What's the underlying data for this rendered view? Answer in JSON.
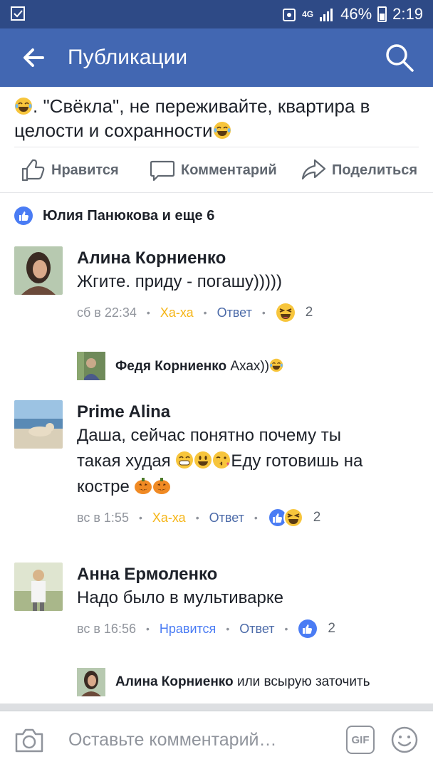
{
  "status": {
    "battery": "46%",
    "time": "2:19",
    "network": "4G"
  },
  "header": {
    "title": "Публикации"
  },
  "post": {
    "line1_start": ". \"Свёкла\", не переживайте, квартира в",
    "line2": "целости и сохранности"
  },
  "actions": {
    "like": "Нравится",
    "comment": "Комментарий",
    "share": "Поделиться"
  },
  "reactions": {
    "text": "Юлия Панюкова и еще 6"
  },
  "comments": [
    {
      "name": "Алина Корниенко",
      "text": "Жгите. приду - погашу)))))",
      "time": "сб в 22:34",
      "reaction_label": "Ха-ха",
      "reply": "Ответ",
      "count": "2"
    },
    {
      "name": "Prime Alina",
      "line1": "Даша, сейчас понятно почему ты",
      "line2_start": "такая худая ",
      "line2_end": "Еду готовишь на",
      "line3": "костре ",
      "time": "вс в 1:55",
      "reaction_label": "Ха-ха",
      "reply": "Ответ",
      "count": "2"
    },
    {
      "name": "Анна Ермоленко",
      "text": "Надо было в мультиварке",
      "time": "вс в 16:56",
      "reaction_label": "Нравится",
      "reply": "Ответ",
      "count": "2"
    }
  ],
  "replies": [
    {
      "name": "Федя Корниенко",
      "text": "Ахах))"
    },
    {
      "name": "Алина Корниенко",
      "text": "или всырую заточить"
    }
  ],
  "composer": {
    "placeholder": "Оставьте комментарий…",
    "gif": "GIF"
  },
  "colors": {
    "header": "#4267b2",
    "statusbar": "#2e4a86",
    "like_blue": "#4a7cf4",
    "haha_yellow": "#f5b517",
    "link": "#4b6aa8"
  }
}
